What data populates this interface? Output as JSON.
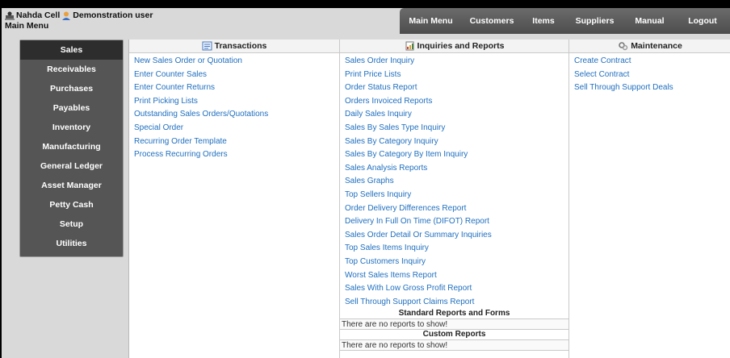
{
  "header": {
    "company": "Nahda Cell",
    "user": "Demonstration user",
    "page_title": "Main Menu"
  },
  "topnav": [
    {
      "label": "Main Menu",
      "name": "topnav-main-menu"
    },
    {
      "label": "Customers",
      "name": "topnav-customers"
    },
    {
      "label": "Items",
      "name": "topnav-items"
    },
    {
      "label": "Suppliers",
      "name": "topnav-suppliers"
    },
    {
      "label": "Manual",
      "name": "topnav-manual"
    },
    {
      "label": "Logout",
      "name": "topnav-logout"
    }
  ],
  "sidebar": {
    "active": "Sales",
    "items": [
      "Sales",
      "Receivables",
      "Purchases",
      "Payables",
      "Inventory",
      "Manufacturing",
      "General Ledger",
      "Asset Manager",
      "Petty Cash",
      "Setup",
      "Utilities"
    ]
  },
  "transactions": {
    "title": "Transactions",
    "icon": "transactions-icon",
    "links": [
      "New Sales Order or Quotation",
      "Enter Counter Sales",
      "Enter Counter Returns",
      "Print Picking Lists",
      "Outstanding Sales Orders/Quotations",
      "Special Order",
      "Recurring Order Template",
      "Process Recurring Orders"
    ]
  },
  "inquiries": {
    "title": "Inquiries and Reports",
    "icon": "reports-icon",
    "links": [
      "Sales Order Inquiry",
      "Print Price Lists",
      "Order Status Report",
      "Orders Invoiced Reports",
      "Daily Sales Inquiry",
      "Sales By Sales Type Inquiry",
      "Sales By Category Inquiry",
      "Sales By Category By Item Inquiry",
      "Sales Analysis Reports",
      "Sales Graphs",
      "Top Sellers Inquiry",
      "Order Delivery Differences Report",
      "Delivery In Full On Time (DIFOT) Report",
      "Sales Order Detail Or Summary Inquiries",
      "Top Sales Items Inquiry",
      "Top Customers Inquiry",
      "Worst Sales Items Report",
      "Sales With Low Gross Profit Report",
      "Sell Through Support Claims Report"
    ],
    "standard_title": "Standard Reports and Forms",
    "standard_empty": "There are no reports to show!",
    "custom_title": "Custom Reports",
    "custom_empty": "There are no reports to show!"
  },
  "maintenance": {
    "title": "Maintenance",
    "icon": "maintenance-icon",
    "links": [
      "Create Contract",
      "Select Contract",
      "Sell Through Support Deals"
    ]
  },
  "colors": {
    "link": "#1f6fbf",
    "nav_bg": "#555555",
    "nav_active": "#2d2d2d",
    "page_bg": "#d9d9d9"
  }
}
